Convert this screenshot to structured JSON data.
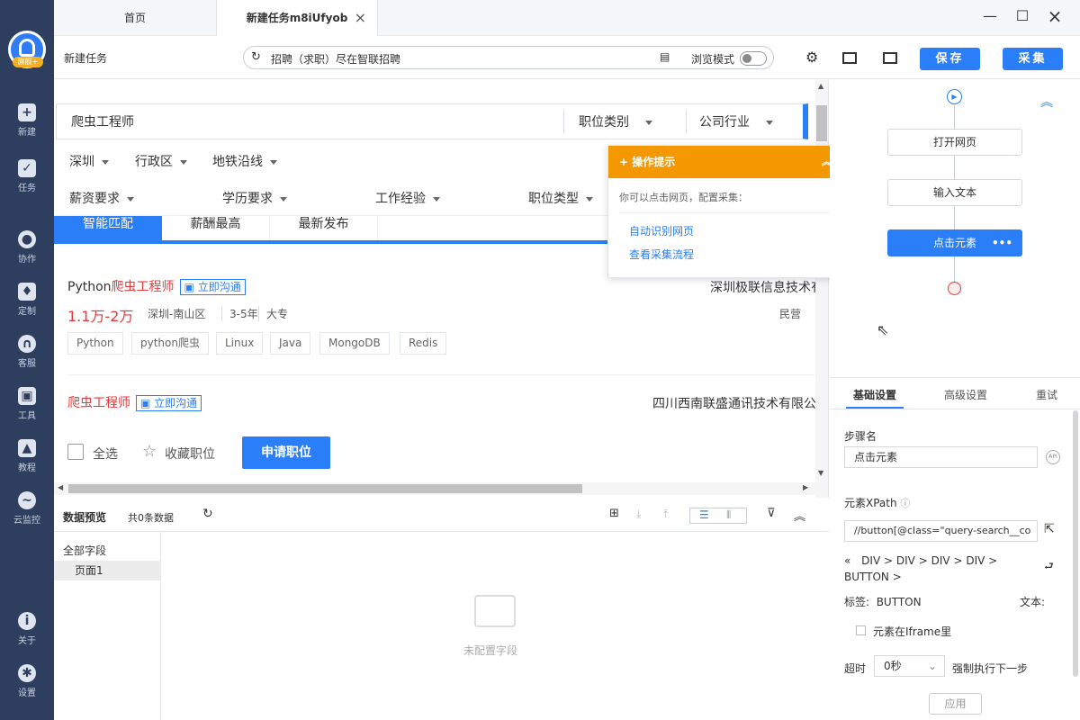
{
  "sidebar": {
    "items": [
      {
        "label": "新建",
        "icon": "plus-icon"
      },
      {
        "label": "任务",
        "icon": "task-icon"
      },
      {
        "label": "协作",
        "icon": "team-icon"
      },
      {
        "label": "定制",
        "icon": "custom-icon"
      },
      {
        "label": "客服",
        "icon": "headset-icon"
      },
      {
        "label": "工具",
        "icon": "toolbox-icon"
      },
      {
        "label": "教程",
        "icon": "tutorial-icon"
      },
      {
        "label": "云监控",
        "icon": "cloud-monitor-icon"
      },
      {
        "label": "关于",
        "icon": "info-icon"
      },
      {
        "label": "设置",
        "icon": "gear-icon"
      }
    ],
    "logo_tag": "旗舰+"
  },
  "tabs": [
    {
      "label": "首页"
    },
    {
      "label": "新建任务m8iUfyob"
    }
  ],
  "toolbar": {
    "title": "新建任务",
    "url": "招聘（求职）尽在智联招聘",
    "browse_mode_label": "浏览模式",
    "save_label": "保存",
    "collect_label": "采集"
  },
  "page": {
    "search_text": "爬虫工程师",
    "job_category": "职位类别",
    "industry": "公司行业",
    "filters_row1": [
      "深圳",
      "行政区",
      "地铁沿线"
    ],
    "filters_row2": [
      "薪资要求",
      "学历要求",
      "工作经验",
      "职位类型"
    ],
    "sort_tabs": [
      "智能匹配",
      "薪酬最高",
      "最新发布"
    ],
    "jobs": [
      {
        "title_prefix": "Python",
        "title_hl": "爬虫工程师",
        "chat": "立即沟通",
        "company": "深圳极联信息技术有",
        "salary": "1.1万-2万",
        "meta": [
          "深圳-南山区",
          "3-5年",
          "大专"
        ],
        "company_type": "民营",
        "tags": [
          "Python",
          "python爬虫",
          "Linux",
          "Java",
          "MongoDB",
          "Redis"
        ]
      },
      {
        "title_prefix": "",
        "title_hl": "爬虫工程师",
        "chat": "立即沟通",
        "company": "四川西南联盛通讯技术有限公"
      }
    ],
    "select_all": "全选",
    "favorite": "收藏职位",
    "apply": "申请职位"
  },
  "popup": {
    "title": "操作提示",
    "hint": "你可以点击网页，配置采集：",
    "links": [
      "自动识别网页",
      "查看采集流程"
    ]
  },
  "preview": {
    "title": "数据预览",
    "count": "共0条数据",
    "all_fields": "全部字段",
    "page1": "页面1",
    "empty": "未配置字段"
  },
  "flow": {
    "nodes": [
      "打开网页",
      "输入文本",
      "点击元素"
    ]
  },
  "settings": {
    "tabs": [
      "基础设置",
      "高级设置",
      "重试"
    ],
    "step_name_label": "步骤名",
    "step_name_value": "点击元素",
    "xpath_label": "元素XPath",
    "xpath_value": "//button[@class=\"query-search__co",
    "path_parts": [
      "DIV",
      "DIV",
      "DIV",
      "DIV"
    ],
    "path_last": "BUTTON",
    "tag_label": "标签:",
    "tag_value": "BUTTON",
    "text_label": "文本:",
    "iframe_label": "元素在Iframe里",
    "timeout_label": "超时",
    "timeout_value": "0秒",
    "force_label": "强制执行下一步",
    "apply_label": "应用"
  }
}
